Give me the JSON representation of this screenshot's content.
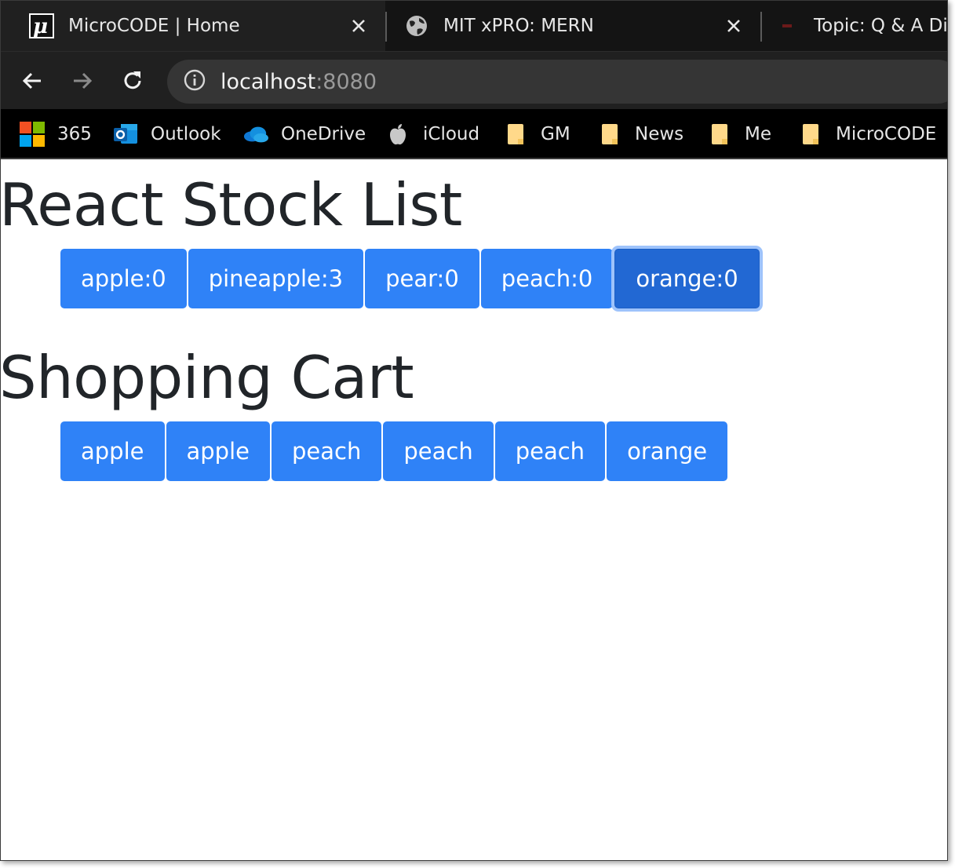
{
  "browser": {
    "tabs": [
      {
        "title": "MicroCODE | Home",
        "icon": "microcode-logo-icon",
        "active": true
      },
      {
        "title": "MIT xPRO: MERN",
        "icon": "globe-icon",
        "active": false
      },
      {
        "title": "Topic: Q & A Dis",
        "icon": "site-favicon-icon",
        "active": false
      }
    ],
    "close_glyph": "✕",
    "address": {
      "host": "localhost",
      "port": ":8080"
    },
    "bookmarks": [
      {
        "label": "365",
        "icon": "microsoft-logo-icon"
      },
      {
        "label": "Outlook",
        "icon": "outlook-icon"
      },
      {
        "label": "OneDrive",
        "icon": "onedrive-cloud-icon"
      },
      {
        "label": "iCloud",
        "icon": "apple-logo-icon"
      },
      {
        "label": "GM",
        "icon": "folder-icon"
      },
      {
        "label": "News",
        "icon": "folder-icon"
      },
      {
        "label": "Me",
        "icon": "folder-icon"
      },
      {
        "label": "MicroCODE",
        "icon": "folder-icon"
      }
    ]
  },
  "page": {
    "stock_heading": "React Stock List",
    "stock_buttons": [
      "apple:0",
      "pineapple:3",
      "pear:0",
      "peach:0",
      "orange:0"
    ],
    "cart_heading": "Shopping Cart",
    "cart_buttons": [
      "apple",
      "apple",
      "peach",
      "peach",
      "peach",
      "orange"
    ]
  },
  "colors": {
    "button": "#2f82f7",
    "button_focused": "#2268d3",
    "heading": "#212529"
  }
}
